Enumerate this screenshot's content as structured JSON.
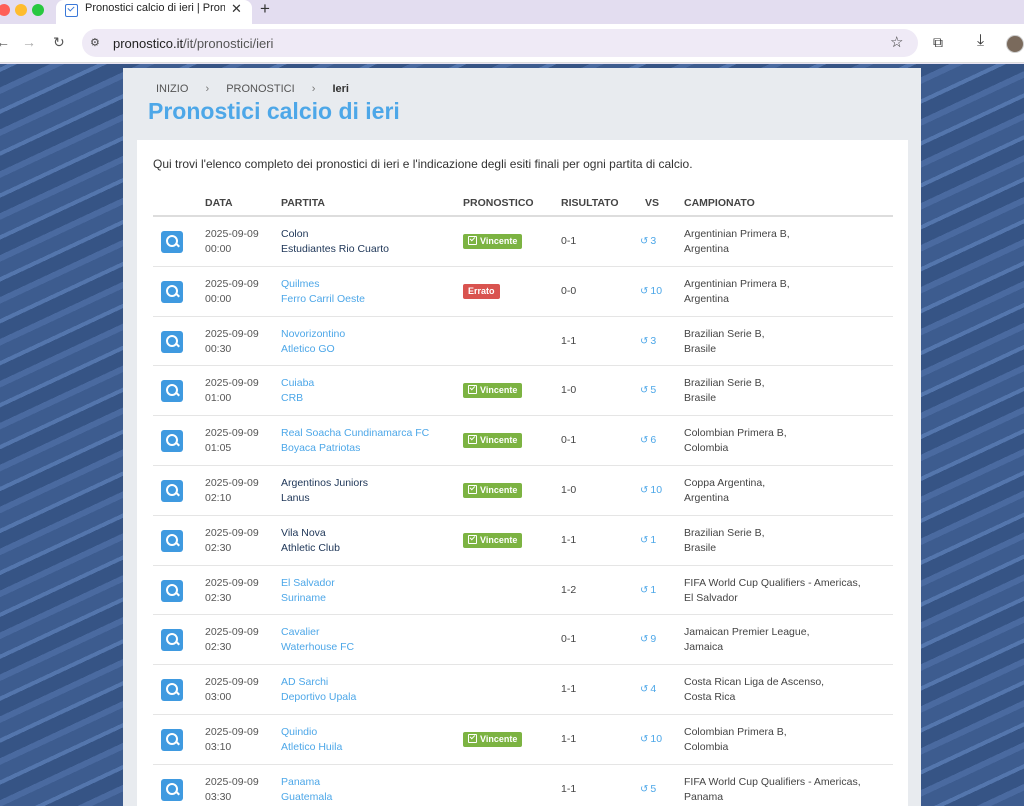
{
  "browser": {
    "tab_title": "Pronostici calcio di ieri | Pronostico.it",
    "url_domain": "pronostico.it",
    "url_path": "/it/pronostici/ieri",
    "new_tab": "+",
    "close_tab": "✕"
  },
  "breadcrumb": {
    "home": "INIZIO",
    "section": "PRONOSTICI",
    "current": "Ieri",
    "sep": "›"
  },
  "page": {
    "title": "Pronostici calcio di ieri",
    "intro": "Qui trovi l'elenco completo dei pronostici di ieri e l'indicazione degli esiti finali per ogni partita di calcio."
  },
  "table": {
    "headers": [
      "DATA",
      "PARTITA",
      "PRONOSTICO",
      "RISULTATO",
      "VS",
      "CAMPIONATO"
    ],
    "rows": [
      {
        "date": "2025-09-09",
        "time": "00:00",
        "home": "Colon",
        "away": "Estudiantes Rio Cuarto",
        "home_link": false,
        "away_link": false,
        "badge": "Vincente",
        "status": "ok",
        "result": "0-1",
        "vs": "3",
        "league": "Argentinian Primera B,",
        "country": "Argentina"
      },
      {
        "date": "2025-09-09",
        "time": "00:00",
        "home": "Quilmes",
        "away": "Ferro Carril Oeste",
        "home_link": true,
        "away_link": true,
        "badge": "Errato",
        "status": "err",
        "result": "0-0",
        "vs": "10",
        "league": "Argentinian Primera B,",
        "country": "Argentina"
      },
      {
        "date": "2025-09-09",
        "time": "00:30",
        "home": "Novorizontino",
        "away": "Atletico GO",
        "home_link": true,
        "away_link": true,
        "badge": "",
        "status": "none",
        "result": "1-1",
        "vs": "3",
        "league": "Brazilian Serie B,",
        "country": "Brasile"
      },
      {
        "date": "2025-09-09",
        "time": "01:00",
        "home": "Cuiaba",
        "away": "CRB",
        "home_link": true,
        "away_link": true,
        "badge": "Vincente",
        "status": "ok",
        "result": "1-0",
        "vs": "5",
        "league": "Brazilian Serie B,",
        "country": "Brasile"
      },
      {
        "date": "2025-09-09",
        "time": "01:05",
        "home": "Real Soacha Cundinamarca FC",
        "away": "Boyaca Patriotas",
        "home_link": true,
        "away_link": true,
        "badge": "Vincente",
        "status": "ok",
        "result": "0-1",
        "vs": "6",
        "league": "Colombian Primera B,",
        "country": "Colombia"
      },
      {
        "date": "2025-09-09",
        "time": "02:10",
        "home": "Argentinos Juniors",
        "away": "Lanus",
        "home_link": false,
        "away_link": false,
        "badge": "Vincente",
        "status": "ok",
        "result": "1-0",
        "vs": "10",
        "league": "Coppa Argentina,",
        "country": "Argentina"
      },
      {
        "date": "2025-09-09",
        "time": "02:30",
        "home": "Vila Nova",
        "away": "Athletic Club",
        "home_link": false,
        "away_link": false,
        "badge": "Vincente",
        "status": "ok",
        "result": "1-1",
        "vs": "1",
        "league": "Brazilian Serie B,",
        "country": "Brasile"
      },
      {
        "date": "2025-09-09",
        "time": "02:30",
        "home": "El Salvador",
        "away": "Suriname",
        "home_link": true,
        "away_link": true,
        "badge": "",
        "status": "none",
        "result": "1-2",
        "vs": "1",
        "league": "FIFA World Cup Qualifiers - Americas,",
        "country": "El Salvador"
      },
      {
        "date": "2025-09-09",
        "time": "02:30",
        "home": "Cavalier",
        "away": "Waterhouse FC",
        "home_link": true,
        "away_link": true,
        "badge": "",
        "status": "none",
        "result": "0-1",
        "vs": "9",
        "league": "Jamaican Premier League,",
        "country": "Jamaica"
      },
      {
        "date": "2025-09-09",
        "time": "03:00",
        "home": "AD Sarchi",
        "away": "Deportivo Upala",
        "home_link": true,
        "away_link": true,
        "badge": "",
        "status": "none",
        "result": "1-1",
        "vs": "4",
        "league": "Costa Rican Liga de Ascenso,",
        "country": "Costa Rica"
      },
      {
        "date": "2025-09-09",
        "time": "03:10",
        "home": "Quindio",
        "away": "Atletico Huila",
        "home_link": true,
        "away_link": true,
        "badge": "Vincente",
        "status": "ok",
        "result": "1-1",
        "vs": "10",
        "league": "Colombian Primera B,",
        "country": "Colombia"
      },
      {
        "date": "2025-09-09",
        "time": "03:30",
        "home": "Panama",
        "away": "Guatemala",
        "home_link": true,
        "away_link": true,
        "badge": "",
        "status": "none",
        "result": "1-1",
        "vs": "5",
        "league": "FIFA World Cup Qualifiers - Americas,",
        "country": "Panama"
      }
    ]
  },
  "colors": {
    "accent": "#4da7e8",
    "win": "#7cb342",
    "lose": "#d9534f",
    "zoom_button": "#3f9ae0"
  }
}
